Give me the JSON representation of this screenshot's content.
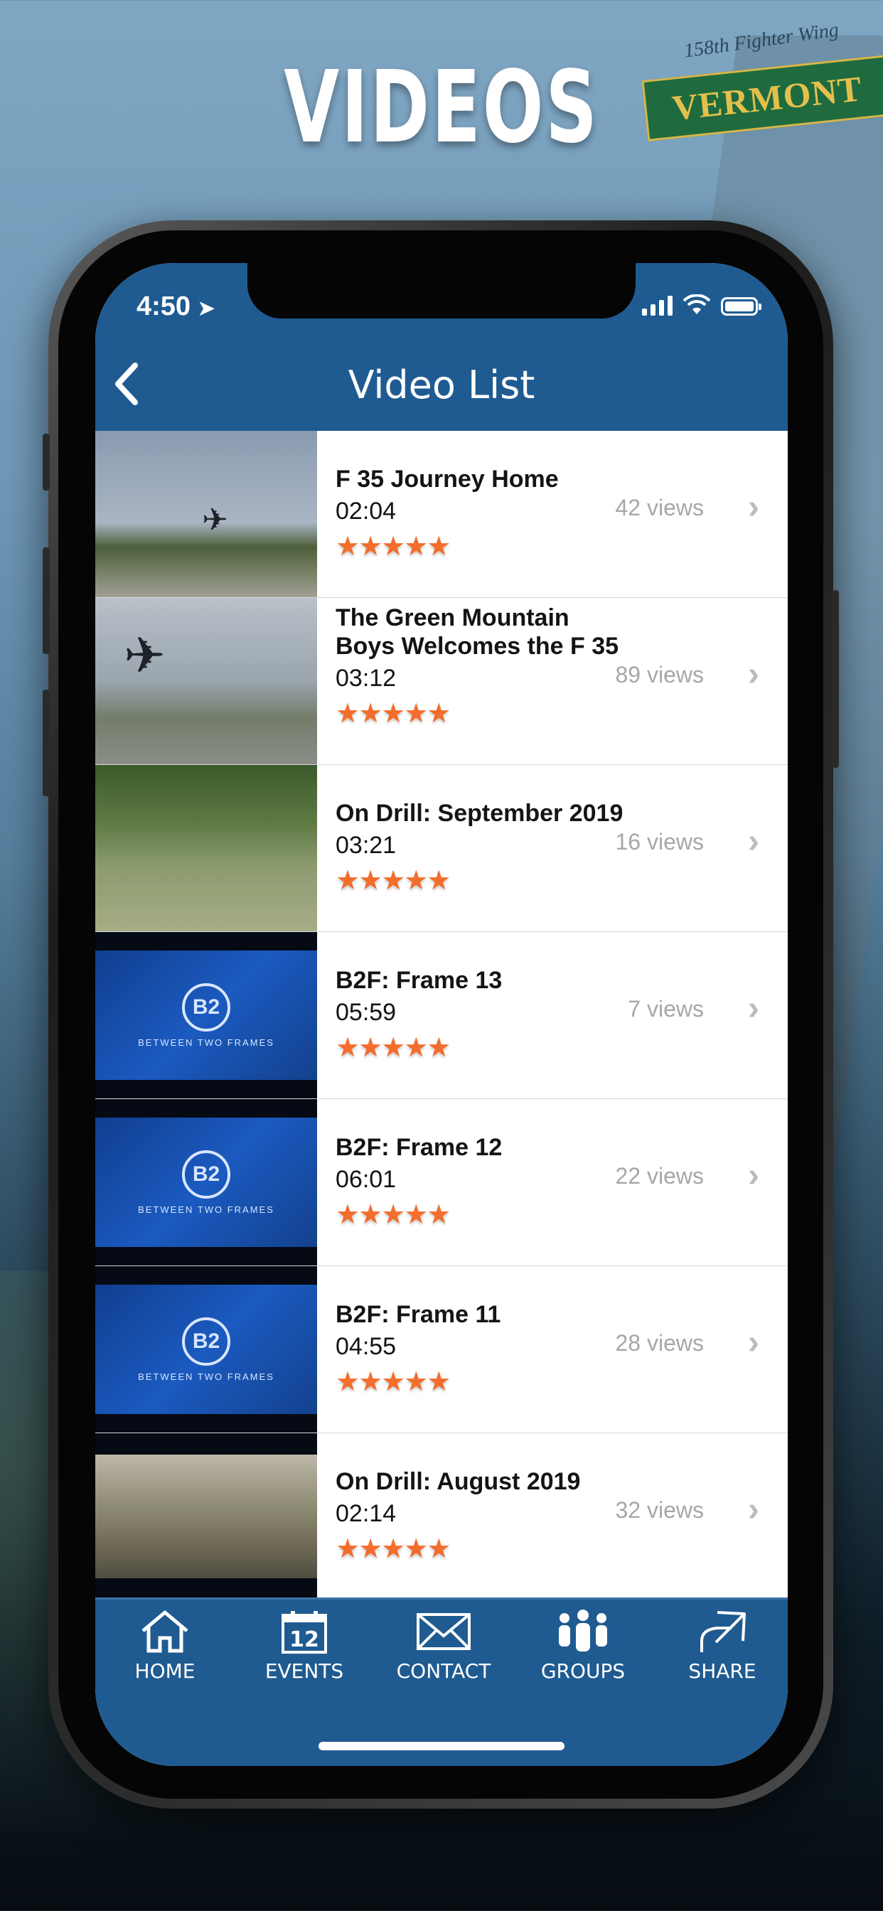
{
  "hero": {
    "title": "VIDEOS"
  },
  "background": {
    "tail_top": "158th Fighter Wing",
    "tail_band": "VERMONT"
  },
  "status": {
    "time": "4:50"
  },
  "nav": {
    "title": "Video List",
    "back_icon": "chevron-left-icon"
  },
  "videos": [
    {
      "title": "F 35 Journey Home",
      "duration": "02:04",
      "views": "42 views",
      "rating": 5
    },
    {
      "title": "The Green Mountain Boys Welcomes the F 35",
      "duration": "03:12",
      "views": "89 views",
      "rating": 5
    },
    {
      "title": "On Drill: September 2019",
      "duration": "03:21",
      "views": "16 views",
      "rating": 5
    },
    {
      "title": "B2F: Frame 13",
      "duration": "05:59",
      "views": "7 views",
      "rating": 5
    },
    {
      "title": "B2F: Frame 12",
      "duration": "06:01",
      "views": "22 views",
      "rating": 5
    },
    {
      "title": "B2F: Frame 11",
      "duration": "04:55",
      "views": "28 views",
      "rating": 5
    },
    {
      "title": "On Drill: August 2019",
      "duration": "02:14",
      "views": "32 views",
      "rating": 5
    }
  ],
  "thumb_text": {
    "b2f_mark": "B2",
    "b2f_caption": "BETWEEN TWO FRAMES"
  },
  "stars": "★★★★★",
  "tabs": [
    {
      "label": "HOME",
      "icon": "home-icon"
    },
    {
      "label": "EVENTS",
      "icon": "calendar-icon"
    },
    {
      "label": "CONTACT",
      "icon": "envelope-icon"
    },
    {
      "label": "GROUPS",
      "icon": "people-icon"
    },
    {
      "label": "SHARE",
      "icon": "share-icon"
    }
  ],
  "calendar_day": "12",
  "colors": {
    "header": "#1f5b91",
    "star": "#f36d2c",
    "views": "#a7a7a7"
  }
}
